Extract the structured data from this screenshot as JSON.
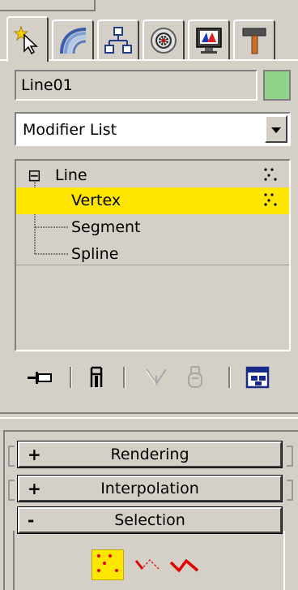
{
  "command_panel": {
    "tabs": [
      {
        "id": "create",
        "icon": "create-star-cursor-icon",
        "active": true
      },
      {
        "id": "modify",
        "icon": "modify-rainbow-icon",
        "active": false
      },
      {
        "id": "hierarchy",
        "icon": "hierarchy-icon",
        "active": false
      },
      {
        "id": "motion",
        "icon": "motion-wheel-icon",
        "active": false
      },
      {
        "id": "display",
        "icon": "display-monitor-icon",
        "active": false
      },
      {
        "id": "utilities",
        "icon": "utilities-hammer-icon",
        "active": false
      }
    ]
  },
  "object": {
    "name": "Line01",
    "color": "#90d48c"
  },
  "modifier_list": {
    "label": "Modifier List"
  },
  "stack": {
    "root": {
      "toggle": "⊟",
      "label": "Line"
    },
    "subobjects": [
      {
        "label": "Vertex",
        "selected": true
      },
      {
        "label": "Segment",
        "selected": false
      },
      {
        "label": "Spline",
        "selected": false
      }
    ],
    "highlight_color": "#ffe600"
  },
  "stack_toolbar": {
    "icons": [
      "pin-stack-icon",
      "show-end-result-icon",
      "make-unique-icon",
      "remove-modifier-icon",
      "configure-modifier-sets-icon"
    ]
  },
  "rollouts": [
    {
      "sign": "+",
      "title": "Rendering",
      "expanded": false
    },
    {
      "sign": "+",
      "title": "Interpolation",
      "expanded": false
    },
    {
      "sign": "-",
      "title": "Selection",
      "expanded": true
    }
  ],
  "selection": {
    "buttons": [
      {
        "icon": "vertex-select-icon",
        "active": true
      },
      {
        "icon": "segment-select-icon",
        "active": false
      },
      {
        "icon": "spline-select-icon",
        "active": false
      }
    ]
  }
}
